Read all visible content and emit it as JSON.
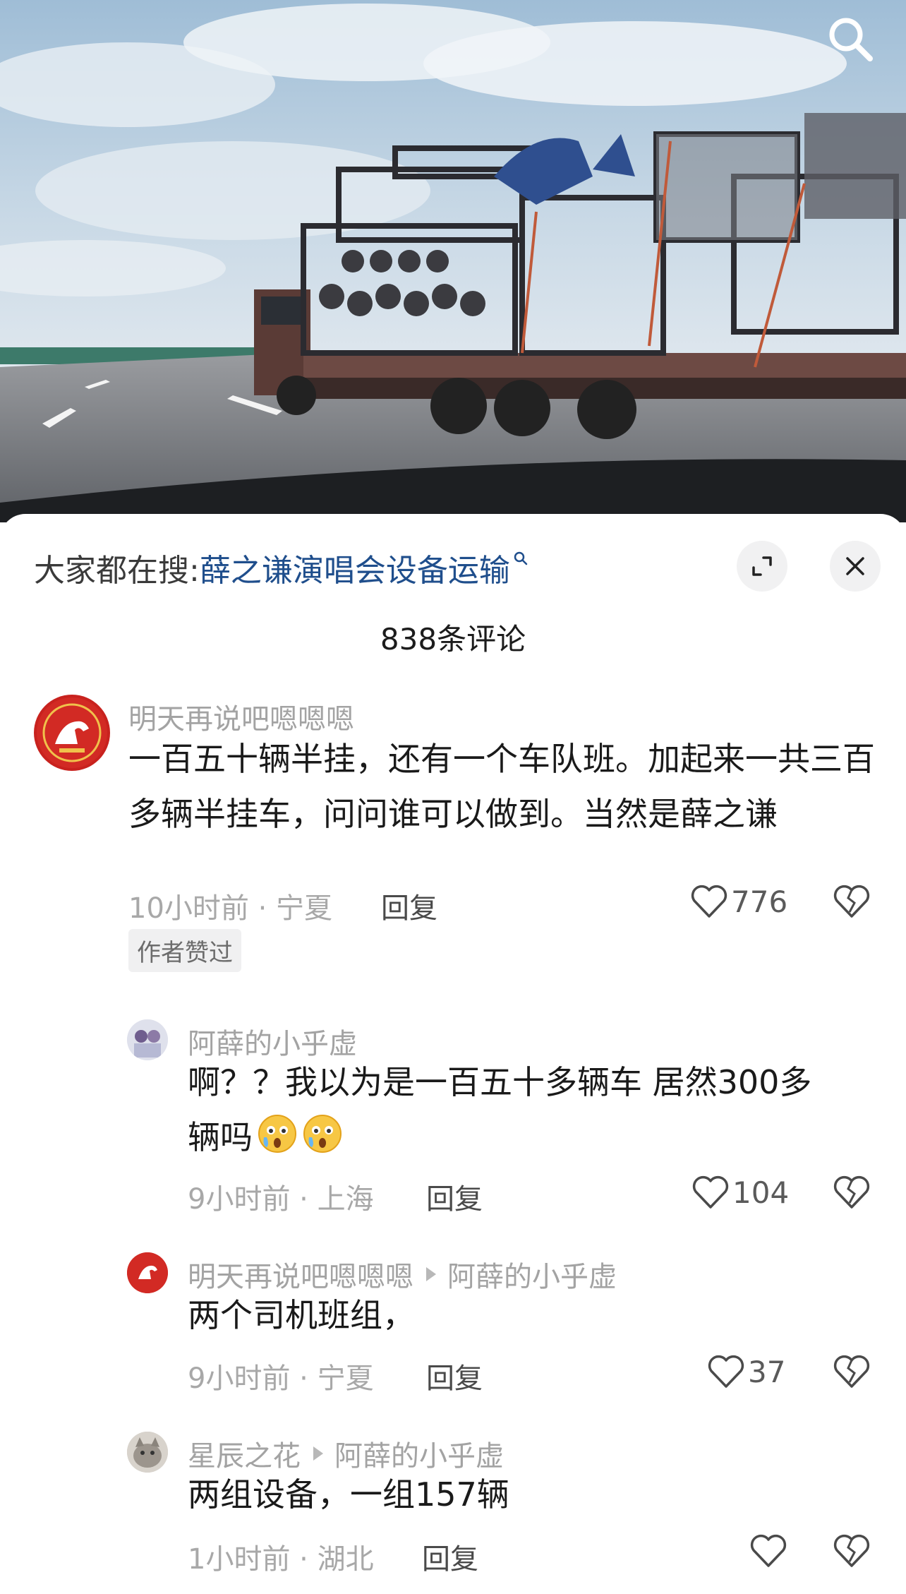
{
  "header": {
    "search_icon": "search-icon",
    "hot_search_label": "大家都在搜:",
    "hot_search_link": "薛之谦演唱会设备运输",
    "expand_icon": "expand-icon",
    "close_icon": "close-icon"
  },
  "comments_count": "838条评论",
  "comments": [
    {
      "name": "明天再说吧嗯嗯嗯",
      "text": "一百五十辆半挂，还有一个车队班。加起来一共三百多辆半挂车，问问谁可以做到。当然是薛之谦",
      "meta": "10小时前 · 宁夏",
      "reply": "回复",
      "likes": "776",
      "tag": "作者赞过"
    },
    {
      "name": "阿薛的小乎虚",
      "text_line1": "啊？？我以为是一百五十多辆车  居然300多",
      "text_line2": "辆吗",
      "emoji": "😲",
      "meta": "9小时前 · 上海",
      "reply": "回复",
      "likes": "104"
    },
    {
      "name": "明天再说吧嗯嗯嗯",
      "reply_to": "阿薛的小乎虚",
      "text": "两个司机班组，",
      "meta": "9小时前 · 宁夏",
      "reply": "回复",
      "likes": "37"
    },
    {
      "name": "星辰之花",
      "reply_to": "阿薛的小乎虚",
      "text": "两组设备，一组157辆",
      "meta": "1小时前 · 湖北",
      "reply": "回复",
      "likes": ""
    }
  ],
  "colors": {
    "link": "#1f4e8c",
    "sheet_bg": "#ffffff"
  }
}
